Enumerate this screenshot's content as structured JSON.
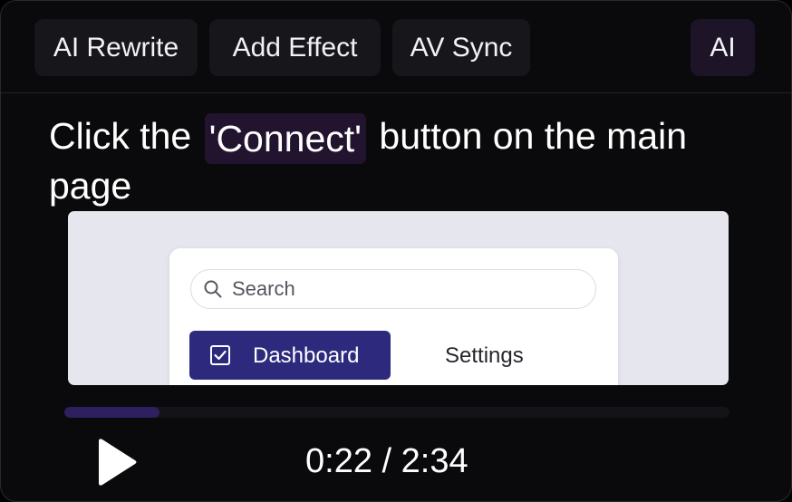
{
  "toolbar": {
    "ai_rewrite_label": "AI Rewrite",
    "add_effect_label": "Add Effect",
    "av_sync_label": "AV Sync",
    "ai_label": "AI"
  },
  "instruction": {
    "prefix": "Click the",
    "highlight": "'Connect'",
    "suffix": "button on the main page"
  },
  "preview": {
    "search_placeholder": "Search",
    "nav_items": [
      {
        "label": "Dashboard",
        "icon": "checkbox-icon",
        "active": true
      },
      {
        "label": "Settings",
        "active": false
      }
    ]
  },
  "player": {
    "progress": 0.143,
    "current_time": "0:22",
    "separator": "/",
    "total_time": "2:34",
    "play_icon": "play-icon"
  },
  "colors": {
    "background": "#0a0a0c",
    "button_bg": "#17171b",
    "ai_button_bg": "#1d1428",
    "highlight_bg": "#22142f",
    "accent": "#2d2a7d",
    "progress_fill": "#2e1f5f"
  }
}
